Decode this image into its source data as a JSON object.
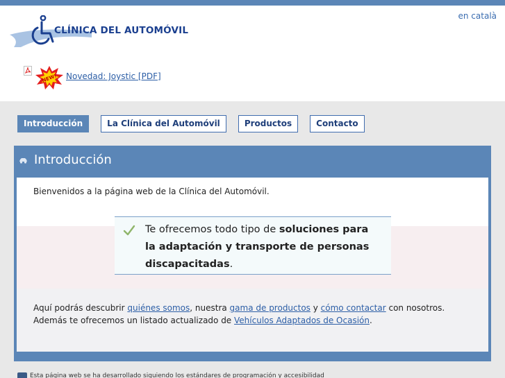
{
  "header": {
    "logo_text": "CLÍNICA DEL AUTOMÓVIL",
    "language_link": "en català",
    "news_link": "Novedad: Joystic [PDF]",
    "new_badge": "NEW!"
  },
  "nav": {
    "tabs": [
      {
        "label": "Introducción",
        "active": true
      },
      {
        "label": "La Clínica del Automóvil",
        "active": false
      },
      {
        "label": "Productos",
        "active": false
      },
      {
        "label": "Contacto",
        "active": false
      }
    ]
  },
  "panel": {
    "title": "Introducción",
    "welcome": "Bienvenidos a la página web de la Clínica del Automóvil.",
    "highlight": {
      "prefix": "Te ofrecemos todo tipo de ",
      "bold": "soluciones para la adaptación y transporte de personas discapacitadas",
      "suffix": "."
    },
    "line1": {
      "t1": "Aquí podrás descubrir ",
      "link1": "quiénes somos",
      "t2": ", nuestra ",
      "link2": "gama de productos",
      "t3": " y ",
      "link3": "cómo contactar",
      "t4": " con nosotros."
    },
    "line2": {
      "t1": "Además te ofrecemos un listado actualizado de ",
      "link1": "Vehículos Adaptados de Ocasión",
      "t2": "."
    }
  },
  "footer": {
    "text": "Esta página web se ha desarrollado siguiendo los estándares de programación y accesibilidad"
  },
  "colors": {
    "brand_blue": "#5b86b7",
    "logo_blue": "#1a3f8f",
    "link_blue": "#2c5ea6"
  }
}
